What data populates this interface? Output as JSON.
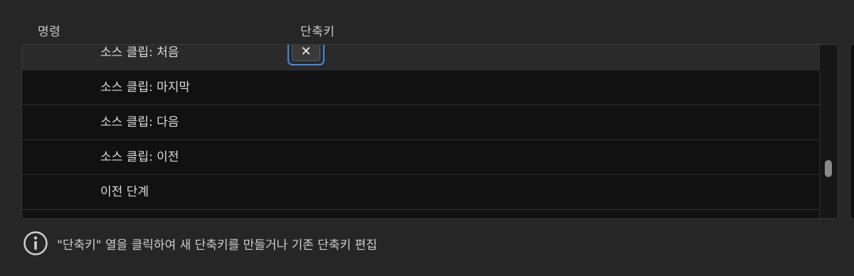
{
  "columns": {
    "command": "명령",
    "shortcut": "단축키"
  },
  "rows": [
    {
      "command": "소스 클립: 처음",
      "selected": true,
      "shortcut_clear_icon": "close-icon",
      "shortcut_clear_glyph": "✕"
    },
    {
      "command": "소스 클립: 마지막"
    },
    {
      "command": "소스 클립: 다음"
    },
    {
      "command": "소스 클립: 이전"
    },
    {
      "command": "이전 단계"
    }
  ],
  "info": {
    "icon": "info-icon",
    "text": "\"단축키\" 열을 클릭하여 새 단축키를 만들거나 기존 단축키 편집"
  },
  "colors": {
    "accent": "#3d8ee6",
    "background": "#262626",
    "table_background": "#111111",
    "selected_row": "#2a2a2a"
  }
}
